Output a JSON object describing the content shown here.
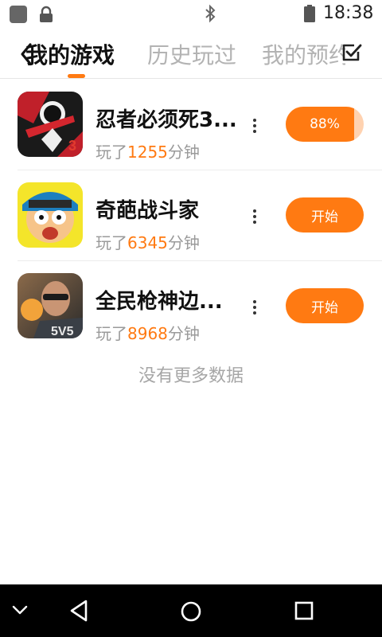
{
  "status_bar": {
    "time": "18:38",
    "icons": [
      "app-notification-icon",
      "lock-icon",
      "bluetooth-icon",
      "battery-icon"
    ]
  },
  "header": {
    "tabs": [
      {
        "label": "我的游戏",
        "active": true
      },
      {
        "label": "历史玩过",
        "active": false
      },
      {
        "label": "我的预约",
        "active": false
      }
    ],
    "accent_color": "#ff7a12"
  },
  "games": [
    {
      "name": "忍者必须死3...",
      "played_prefix": "玩了",
      "minutes": "1255",
      "played_suffix": "分钟",
      "button": "88%",
      "progress": 0.88
    },
    {
      "name": "奇葩战斗家",
      "played_prefix": "玩了",
      "minutes": "6345",
      "played_suffix": "分钟",
      "button": "开始"
    },
    {
      "name": "全民枪神边...",
      "played_prefix": "玩了",
      "minutes": "8968",
      "played_suffix": "分钟",
      "button": "开始"
    }
  ],
  "footer_text": "没有更多数据",
  "nav_bar": [
    "collapse-icon",
    "back-icon",
    "home-icon",
    "recents-icon"
  ]
}
